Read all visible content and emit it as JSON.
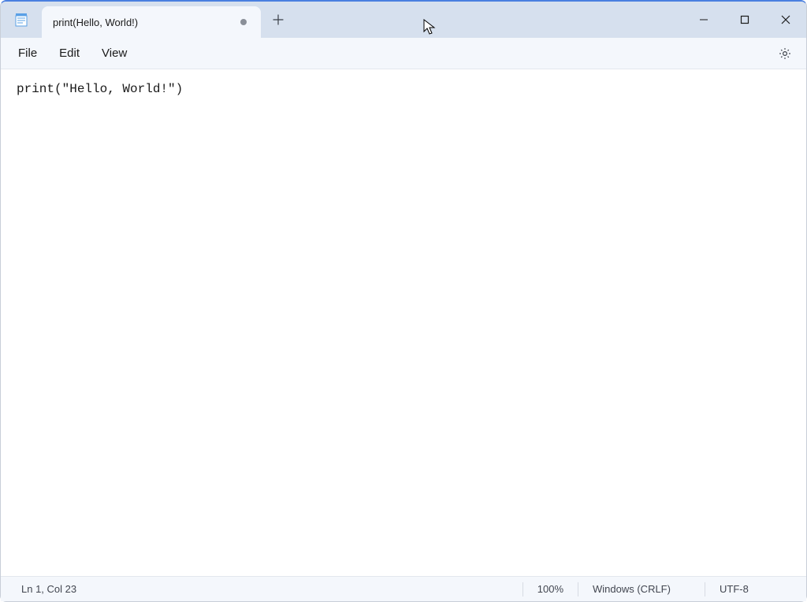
{
  "tab": {
    "title": "print(Hello, World!)",
    "dirty": true
  },
  "menu": {
    "file": "File",
    "edit": "Edit",
    "view": "View"
  },
  "editor": {
    "content": "print(\"Hello, World!\")"
  },
  "status": {
    "position": "Ln 1, Col 23",
    "zoom": "100%",
    "line_ending": "Windows (CRLF)",
    "encoding": "UTF-8"
  }
}
